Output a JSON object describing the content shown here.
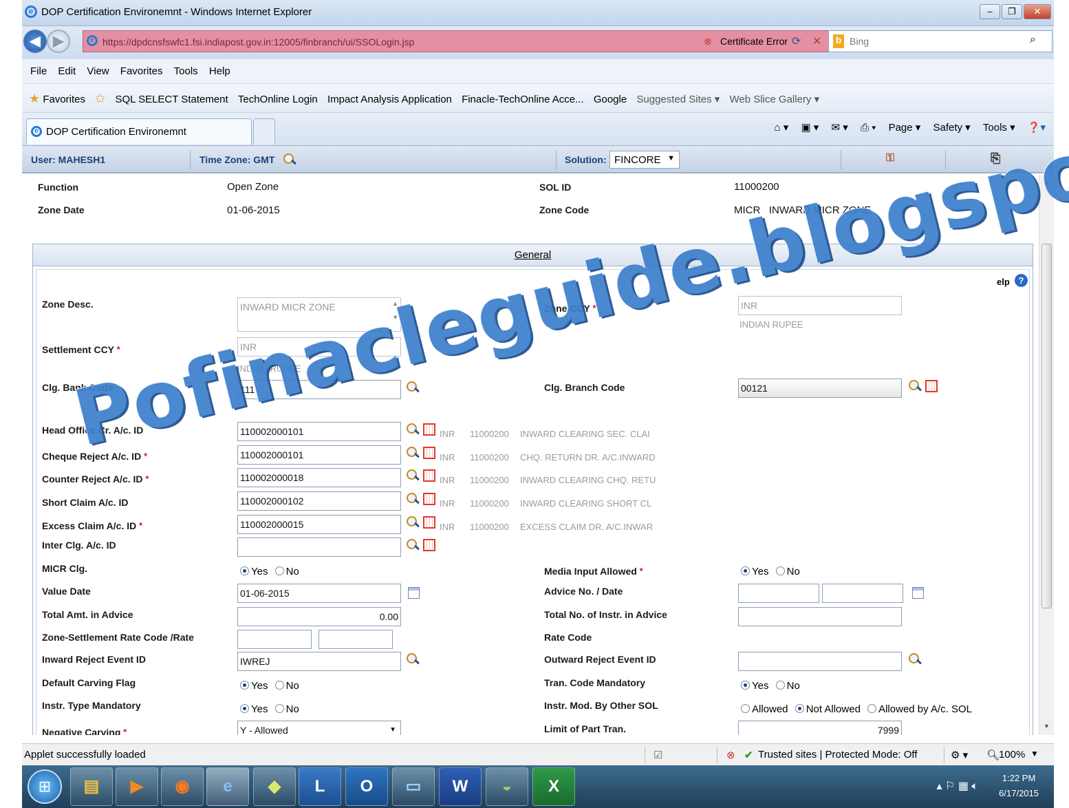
{
  "window": {
    "title": "DOP Certification Environemnt - Windows Internet Explorer",
    "min": "–",
    "max": "❐",
    "close": "✕"
  },
  "navbar": {
    "back": "◀",
    "forward": "▶",
    "url": "https://dpdcnsfswfc1.fsi.indiapost.gov.in:12005/finbranch/ui/SSOLogin.jsp",
    "cert_error": "Certificate Error",
    "search_placeholder": "Bing"
  },
  "menu": [
    "File",
    "Edit",
    "View",
    "Favorites",
    "Tools",
    "Help"
  ],
  "favorites": {
    "label": "Favorites",
    "items": [
      "SQL SELECT Statement",
      "TechOnline Login",
      "Impact Analysis Application",
      "Finacle-TechOnline Acce...",
      "Google",
      "Suggested Sites ▾",
      "Web Slice Gallery ▾"
    ]
  },
  "tab": {
    "title": "DOP Certification Environemnt"
  },
  "commandbar": [
    "Page ▾",
    "Safety ▾",
    "Tools ▾"
  ],
  "header": {
    "user": "User: MAHESH1",
    "timezone": "Time Zone: GMT",
    "solution_label": "Solution:",
    "solution_value": "FINCORE"
  },
  "summary": {
    "function_label": "Function",
    "function_value": "Open Zone",
    "zone_date_label": "Zone Date",
    "zone_date_value": "01-06-2015",
    "sol_id_label": "SOL ID",
    "sol_id_value": "11000200",
    "zone_code_label": "Zone Code",
    "zone_code_value": "MICR   INWARD MICR ZONE"
  },
  "general": {
    "section_title": "General",
    "help_label": "elp",
    "zone_desc_label": "Zone Desc.",
    "zone_desc_value": "INWARD MICR ZONE",
    "zone_ccy_label": "Zone CCY",
    "zone_ccy_value": "INR",
    "zone_ccy_desc": "INDIAN RUPEE",
    "settlement_ccy_label": "Settlement CCY",
    "settlement_ccy_value": "INR",
    "settlement_ccy_desc": "INDIAN RUPEE",
    "clg_bank_code_label": "Clg. Bank Code",
    "clg_bank_code_value": "111",
    "clg_branch_code_label": "Clg. Branch Code",
    "clg_branch_code_value": "00121",
    "accounts": [
      {
        "label": "Head Office Cr. A/c. ID",
        "value": "110002000101",
        "ccy": "INR",
        "sol": "11000200",
        "desc": "INWARD CLEARING  SEC. CLAI"
      },
      {
        "label": "Cheque Reject A/c. ID",
        "value": "110002000101",
        "ccy": "INR",
        "sol": "11000200",
        "desc": "CHQ. RETURN DR. A/C.INWARD"
      },
      {
        "label": "Counter Reject A/c. ID",
        "value": "110002000018",
        "ccy": "INR",
        "sol": "11000200",
        "desc": "INWARD CLEARING CHQ. RETU"
      },
      {
        "label": "Short Claim A/c. ID",
        "value": "110002000102",
        "ccy": "INR",
        "sol": "11000200",
        "desc": "INWARD CLEARING  SHORT CL"
      },
      {
        "label": "Excess Claim A/c. ID",
        "value": "110002000015",
        "ccy": "INR",
        "sol": "11000200",
        "desc": "EXCESS CLAIM DR. A/C.INWAR"
      }
    ],
    "inter_clg_label": "Inter Clg. A/c. ID",
    "micr_clg_label": "MICR Clg.",
    "media_input_label": "Media Input Allowed",
    "yes": "Yes",
    "no": "No",
    "value_date_label": "Value Date",
    "value_date_value": "01-06-2015",
    "advice_label": "Advice No. / Date",
    "total_amt_label": "Total Amt. in Advice",
    "total_amt_value": "0.00",
    "total_instr_label": "Total No. of Instr. in Advice",
    "rate_code_zone_label": "Zone-Settlement Rate Code /Rate",
    "rate_code_label": "Rate Code",
    "inward_reject_label": "Inward Reject Event ID",
    "inward_reject_value": "IWREJ",
    "outward_reject_label": "Outward Reject Event ID",
    "default_carving_label": "Default Carving Flag",
    "tran_code_label": "Tran. Code Mandatory",
    "instr_type_label": "Instr. Type Mandatory",
    "instr_mod_label": "Instr. Mod. By Other SOL",
    "instr_mod_options": [
      "Allowed",
      "Not Allowed",
      "Allowed by A/c. SOL"
    ],
    "negative_carving_label": "Negative Carving",
    "negative_carving_value": "Y - Allowed",
    "limit_part_label": "Limit of Part Tran.",
    "limit_part_value": "7999"
  },
  "watermark": "Pofinacleguide.blogspot.in",
  "status": {
    "message": "Applet successfully loaded",
    "zone": "Trusted sites | Protected Mode: Off",
    "zoom": "100%"
  },
  "taskbar": {
    "time": "1:22 PM",
    "date": "6/17/2015"
  }
}
